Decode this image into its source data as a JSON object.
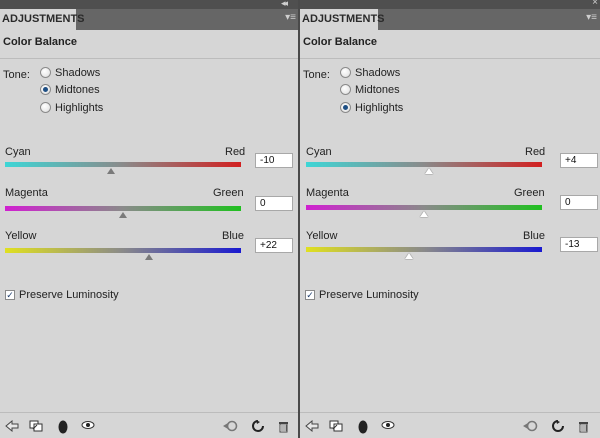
{
  "panels": [
    {
      "tab_label": "ADJUSTMENTS",
      "title": "Color Balance",
      "tone_label": "Tone:",
      "tone_options": [
        {
          "label": "Shadows",
          "checked": false
        },
        {
          "label": "Midtones",
          "checked": true
        },
        {
          "label": "Highlights",
          "checked": false
        }
      ],
      "sliders": [
        {
          "left": "Cyan",
          "right": "Red",
          "value": "-10",
          "numeric": -10
        },
        {
          "left": "Magenta",
          "right": "Green",
          "value": "0",
          "numeric": 0
        },
        {
          "left": "Yellow",
          "right": "Blue",
          "value": "+22",
          "numeric": 22
        }
      ],
      "preserve_luminosity": {
        "label": "Preserve Luminosity",
        "checked": true,
        "check_glyph": "✓"
      }
    },
    {
      "tab_label": "ADJUSTMENTS",
      "title": "Color Balance",
      "tone_label": "Tone:",
      "tone_options": [
        {
          "label": "Shadows",
          "checked": false
        },
        {
          "label": "Midtones",
          "checked": false
        },
        {
          "label": "Highlights",
          "checked": true
        }
      ],
      "sliders": [
        {
          "left": "Cyan",
          "right": "Red",
          "value": "+4",
          "numeric": 4
        },
        {
          "left": "Magenta",
          "right": "Green",
          "value": "0",
          "numeric": 0
        },
        {
          "left": "Yellow",
          "right": "Blue",
          "value": "-13",
          "numeric": -13
        }
      ],
      "preserve_luminosity": {
        "label": "Preserve Luminosity",
        "checked": true,
        "check_glyph": "✓"
      }
    }
  ],
  "window_controls": {
    "collapse_glyph": "◂◂",
    "close_glyph": "×",
    "menu_glyph": "▾≡"
  },
  "slider_range": [
    -100,
    100
  ],
  "colors": {
    "cyan": "#3ed6d6",
    "red": "#d22020",
    "magenta": "#d020d0",
    "green": "#20c020",
    "yellow": "#e0e020",
    "blue": "#1a1ad0"
  }
}
